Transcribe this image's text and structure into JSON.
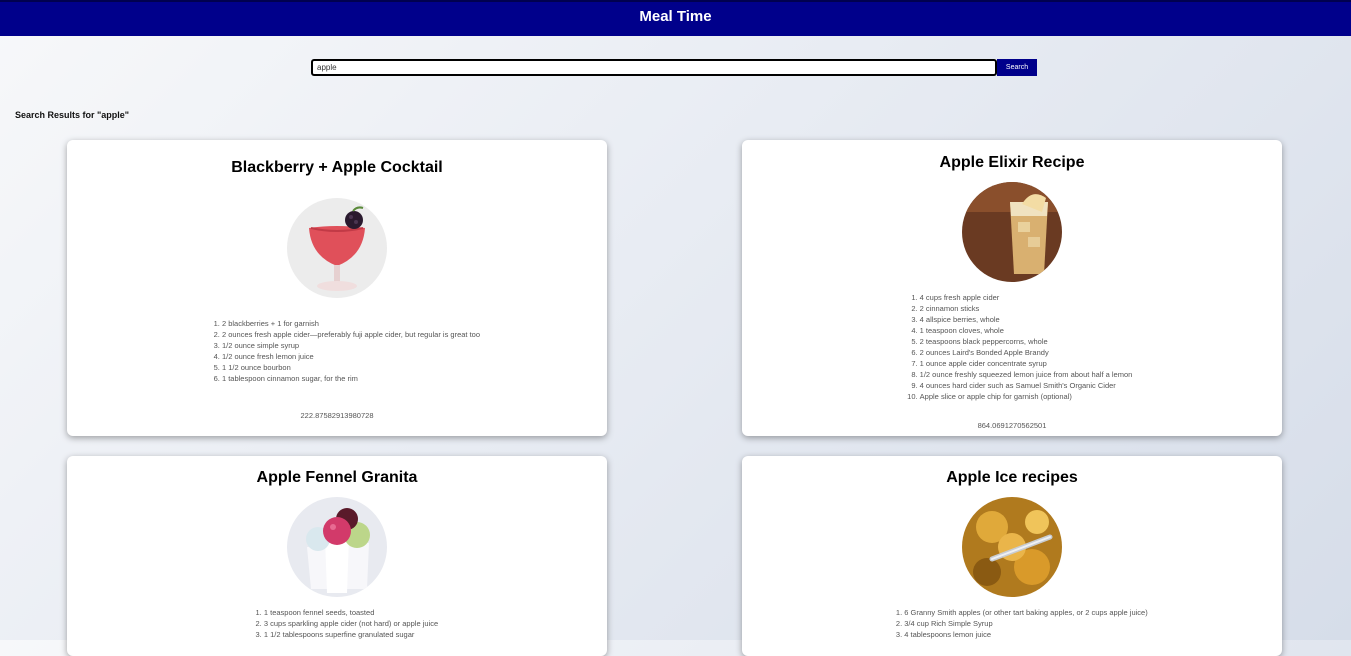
{
  "app": {
    "title": "Meal Time"
  },
  "search": {
    "value": "apple",
    "button_label": "Search"
  },
  "results_heading": "Search Results for \"apple\"",
  "recipes": [
    {
      "title": "Blackberry + Apple Cocktail",
      "ingredients": [
        "2 blackberries + 1 for garnish",
        "2 ounces fresh apple cider—preferably fuji apple cider, but regular is great too",
        "1/2 ounce simple syrup",
        "1/2 ounce fresh lemon juice",
        "1 1/2 ounce bourbon",
        "1 tablespoon cinnamon sugar, for the rim"
      ],
      "score": "222.87582913980728"
    },
    {
      "title": "Apple Elixir Recipe",
      "ingredients": [
        "4 cups fresh apple cider",
        "2 cinnamon sticks",
        "4 allspice berries, whole",
        "1 teaspoon cloves, whole",
        "2 teaspoons black peppercorns, whole",
        "2 ounces Laird's Bonded Apple Brandy",
        "1 ounce apple cider concentrate syrup",
        "1/2 ounce freshly squeezed lemon juice from about half a lemon",
        "4 ounces hard cider such as Samuel Smith's Organic Cider",
        "Apple slice or apple chip for garnish (optional)"
      ],
      "score": "864.0691270562501"
    },
    {
      "title": "Apple Fennel Granita",
      "ingredients": [
        "1 teaspoon fennel seeds, toasted",
        "3 cups sparkling apple cider (not hard) or apple juice",
        "1 1/2 tablespoons superfine granulated sugar"
      ]
    },
    {
      "title": "Apple Ice recipes",
      "ingredients": [
        "6 Granny Smith apples (or other tart baking apples, or 2 cups apple juice)",
        "3/4 cup Rich Simple Syrup",
        "4 tablespoons lemon juice"
      ]
    }
  ]
}
